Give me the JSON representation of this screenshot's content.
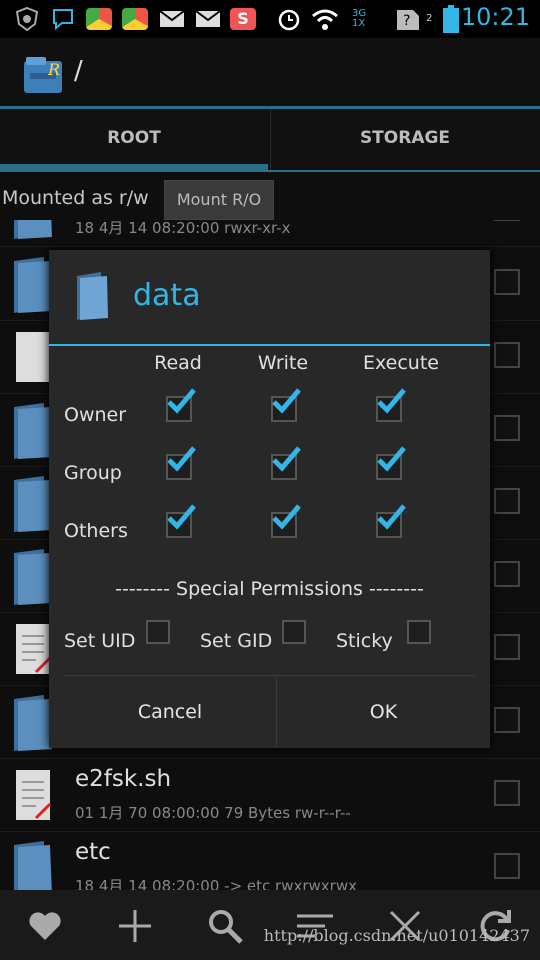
{
  "status_bar": {
    "time": "10:21",
    "network_label_top": "3G",
    "network_label_bottom": "1X",
    "sim_number": "2",
    "icons": [
      "shield-icon",
      "chat-icon",
      "chrome-icon",
      "chrome-icon",
      "mail-icon",
      "mail-icon",
      "s-app-icon",
      "alarm-icon",
      "wifi-icon",
      "signal-icon",
      "no-sim-icon",
      "battery-icon"
    ]
  },
  "action_bar": {
    "path": "/"
  },
  "tabs": [
    {
      "label": "ROOT"
    },
    {
      "label": "STORAGE"
    }
  ],
  "mount": {
    "status": "Mounted as r/w",
    "button": "Mount R/O"
  },
  "file_list": [
    {
      "name": "",
      "meta": "18 4月 14 08:20:00   rwxr-xr-x",
      "type": "folder"
    },
    {
      "name": "",
      "meta": "",
      "type": "folder"
    },
    {
      "name": "",
      "meta": "",
      "type": "file"
    },
    {
      "name": "",
      "meta": "",
      "type": "folder"
    },
    {
      "name": "",
      "meta": "",
      "type": "folder"
    },
    {
      "name": "",
      "meta": "",
      "type": "folder"
    },
    {
      "name": "",
      "meta": "",
      "type": "script"
    },
    {
      "name": "",
      "meta": "",
      "type": "folder"
    },
    {
      "name": "e2fsk.sh",
      "meta": "01 1月 70 08:00:00  79 Bytes  rw-r--r--",
      "type": "script"
    },
    {
      "name": "etc",
      "meta": "18 4月 14 08:20:00  -> etc  rwxrwxrwx",
      "type": "folder"
    }
  ],
  "dialog": {
    "title": "data",
    "columns": [
      "Read",
      "Write",
      "Execute"
    ],
    "rows": [
      {
        "label": "Owner",
        "checks": [
          true,
          true,
          true
        ]
      },
      {
        "label": "Group",
        "checks": [
          true,
          true,
          true
        ]
      },
      {
        "label": "Others",
        "checks": [
          true,
          true,
          true
        ]
      }
    ],
    "special_header": "-------- Special Permissions --------",
    "special": [
      {
        "label": "Set UID",
        "checked": false
      },
      {
        "label": "Set GID",
        "checked": false
      },
      {
        "label": "Sticky",
        "checked": false
      }
    ],
    "cancel": "Cancel",
    "ok": "OK"
  },
  "bottom_bar": {
    "icons": [
      "heart-icon",
      "add-icon",
      "search-icon",
      "sort-icon",
      "close-icon",
      "refresh-icon"
    ]
  },
  "watermark": "http://blog.csdn.net/u010142437",
  "colors": {
    "accent": "#33b5e5",
    "tab_indicator": "#2a6f86"
  }
}
